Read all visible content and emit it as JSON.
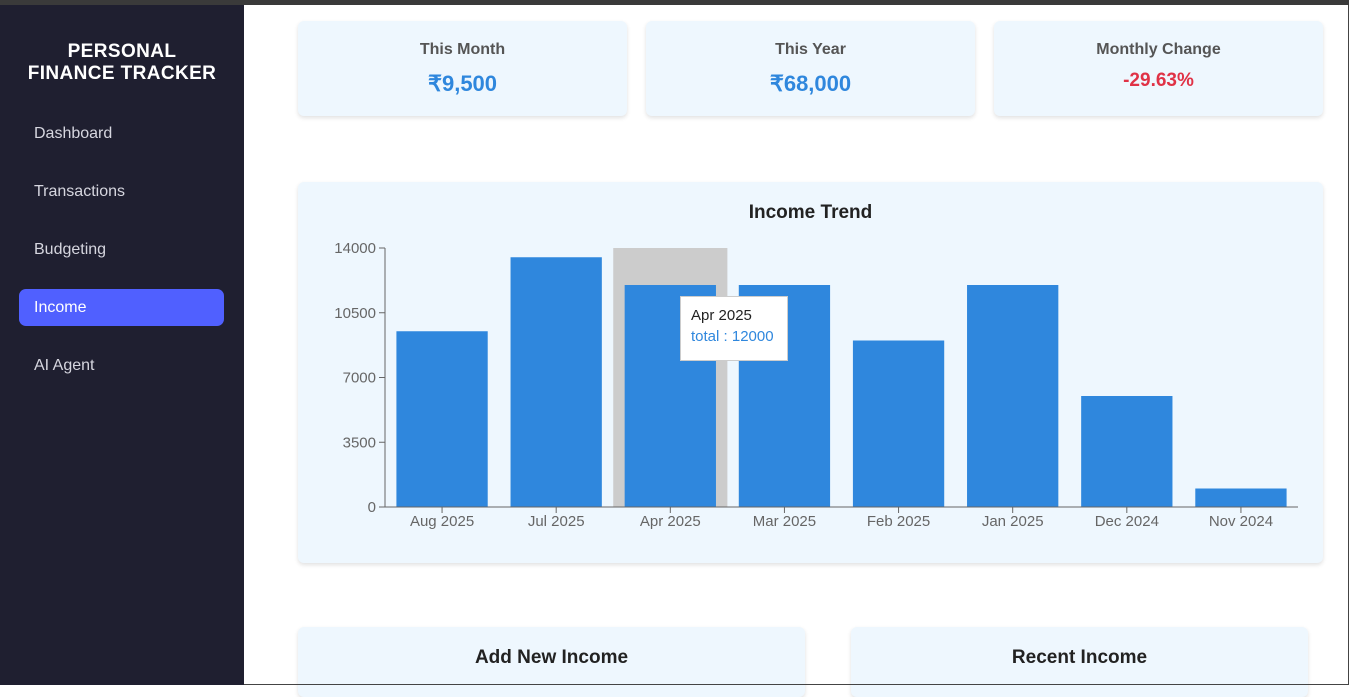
{
  "app": {
    "brand_line1": "PERSONAL",
    "brand_line2": "FINANCE TRACKER"
  },
  "sidebar": {
    "items": [
      {
        "label": "Dashboard",
        "active": false
      },
      {
        "label": "Transactions",
        "active": false
      },
      {
        "label": "Budgeting",
        "active": false
      },
      {
        "label": "Income",
        "active": true
      },
      {
        "label": "AI Agent",
        "active": false
      }
    ]
  },
  "stats": [
    {
      "label": "This Month",
      "value": "₹9,500"
    },
    {
      "label": "This Year",
      "value": "₹68,000"
    },
    {
      "label": "Monthly Change",
      "value": "-29.63%"
    }
  ],
  "colors": {
    "accent": "#2f87dd",
    "negative": "#e03246",
    "sidebar_bg": "#1f1f30",
    "active_nav": "#5060ff",
    "card_bg": "#eef7fe",
    "hover_band": "#cccccc"
  },
  "chart_data": {
    "type": "bar",
    "title": "Income Trend",
    "categories": [
      "Aug 2025",
      "Jul 2025",
      "Apr 2025",
      "Mar 2025",
      "Feb 2025",
      "Jan 2025",
      "Dec 2024",
      "Nov 2024"
    ],
    "series": [
      {
        "name": "total",
        "values": [
          9500,
          13500,
          12000,
          12000,
          9000,
          12000,
          6000,
          1000
        ]
      }
    ],
    "yticks": [
      0,
      3500,
      7000,
      10500,
      14000
    ],
    "ylim": [
      0,
      14000
    ],
    "xlabel": "",
    "ylabel": "",
    "grid": false,
    "highlighted_category": "Apr 2025"
  },
  "tooltip": {
    "label": "Apr 2025",
    "value_text": "total : 12000"
  },
  "sections": {
    "add_income_title": "Add New Income",
    "recent_income_title": "Recent Income"
  }
}
